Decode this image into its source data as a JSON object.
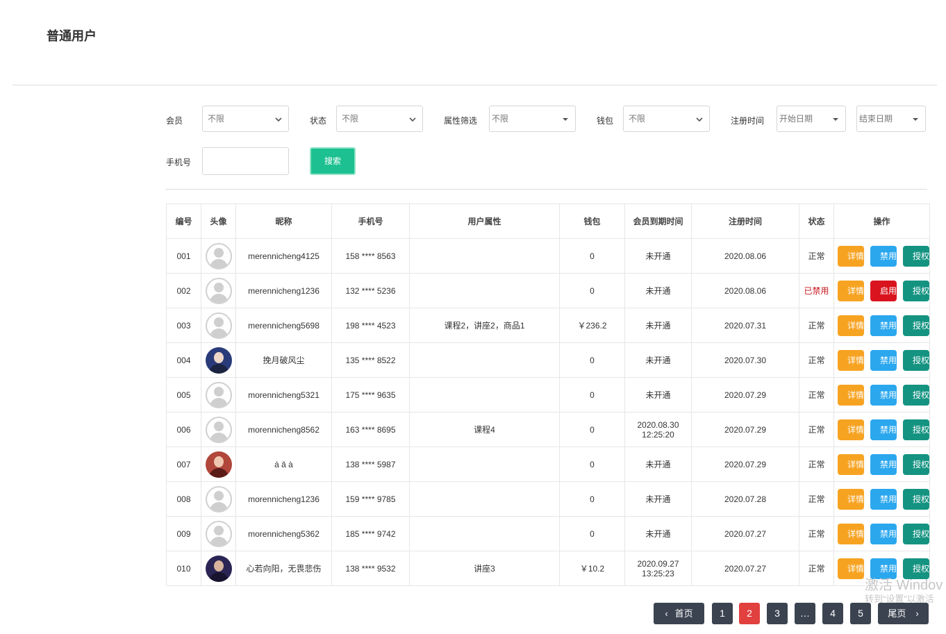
{
  "page": {
    "title": "普通用户"
  },
  "filters": {
    "member": {
      "label": "会员",
      "value": "不限"
    },
    "status": {
      "label": "状态",
      "value": "不限"
    },
    "attribute": {
      "label": "属性筛选",
      "value": "不限"
    },
    "wallet": {
      "label": "钱包",
      "value": "不限"
    },
    "register_time": {
      "label": "注册时间",
      "start_placeholder": "开始日期",
      "end_placeholder": "结束日期"
    },
    "phone": {
      "label": "手机号",
      "value": ""
    },
    "search_label": "搜索"
  },
  "table": {
    "headers": [
      "编号",
      "头像",
      "昵称",
      "手机号",
      "用户属性",
      "钱包",
      "会员到期时间",
      "注册时间",
      "状态",
      "操作"
    ],
    "rows": [
      {
        "id": "001",
        "avatar": "default",
        "nickname": "merennicheng4125",
        "phone": "158 **** 8563",
        "attrs": "",
        "wallet": "0",
        "expire": "未开通",
        "register": "2020.08.06",
        "status": "正常",
        "banned": false
      },
      {
        "id": "002",
        "avatar": "default",
        "nickname": "merennicheng1236",
        "phone": "132 **** 5236",
        "attrs": "",
        "wallet": "0",
        "expire": "未开通",
        "register": "2020.08.06",
        "status": "已禁用",
        "banned": true
      },
      {
        "id": "003",
        "avatar": "default",
        "nickname": "merennicheng5698",
        "phone": "198 **** 4523",
        "attrs": "课程2，讲座2，商品1",
        "wallet": "￥236.2",
        "expire": "未开通",
        "register": "2020.07.31",
        "status": "正常",
        "banned": false
      },
      {
        "id": "004",
        "avatar": "photo-blue",
        "nickname": "挽月破风尘",
        "phone": "135 **** 8522",
        "attrs": "",
        "wallet": "0",
        "expire": "未开通",
        "register": "2020.07.30",
        "status": "正常",
        "banned": false
      },
      {
        "id": "005",
        "avatar": "default",
        "nickname": "morennicheng5321",
        "phone": "175 **** 9635",
        "attrs": "",
        "wallet": "0",
        "expire": "未开通",
        "register": "2020.07.29",
        "status": "正常",
        "banned": false
      },
      {
        "id": "006",
        "avatar": "default",
        "nickname": "morennicheng8562",
        "phone": "163 **** 8695",
        "attrs": "课程4",
        "wallet": "0",
        "expire": "2020.08.30\n12:25:20",
        "register": "2020.07.29",
        "status": "正常",
        "banned": false
      },
      {
        "id": "007",
        "avatar": "photo-red",
        "nickname": "á ǎ à",
        "phone": "138 **** 5987",
        "attrs": "",
        "wallet": "0",
        "expire": "未开通",
        "register": "2020.07.29",
        "status": "正常",
        "banned": false
      },
      {
        "id": "008",
        "avatar": "default",
        "nickname": "morennicheng1236",
        "phone": "159 **** 9785",
        "attrs": "",
        "wallet": "0",
        "expire": "未开通",
        "register": "2020.07.28",
        "status": "正常",
        "banned": false
      },
      {
        "id": "009",
        "avatar": "default",
        "nickname": "morennicheng5362",
        "phone": "185 **** 9742",
        "attrs": "",
        "wallet": "0",
        "expire": "未开通",
        "register": "2020.07.27",
        "status": "正常",
        "banned": false
      },
      {
        "id": "010",
        "avatar": "photo-dark",
        "nickname": "心若向阳，无畏悲伤",
        "phone": "138 **** 9532",
        "attrs": "讲座3",
        "wallet": "￥10.2",
        "expire": "2020.09.27\n13:25:23",
        "register": "2020.07.27",
        "status": "正常",
        "banned": false
      }
    ],
    "actions": {
      "detail": "详情",
      "ban": "禁用",
      "enable": "启用",
      "auth": "授权"
    }
  },
  "pagination": {
    "first_label": "首页",
    "last_label": "尾页",
    "pages": [
      "1",
      "2",
      "3",
      "…",
      "4",
      "5"
    ],
    "current": "2"
  },
  "watermark": {
    "line1": "激活 Windov",
    "line2": "转到“设置”以激活"
  },
  "colors": {
    "accent_green": "#1dc191",
    "detail_orange": "#f7a322",
    "ban_blue": "#2ba7ee",
    "enable_red": "#d9141f",
    "auth_teal": "#149381",
    "pager_dark": "#3b4350",
    "pager_active": "#e1403f"
  }
}
